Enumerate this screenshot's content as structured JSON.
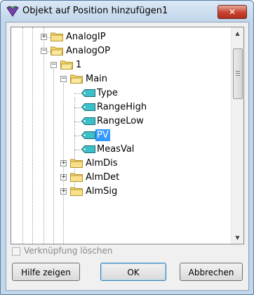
{
  "window": {
    "title": "Objekt auf Position hinzufügen1",
    "close_label": "✕"
  },
  "tree": {
    "nodes": [
      {
        "label": "AnalogIP",
        "kind": "folder",
        "expander": "+"
      },
      {
        "label": "AnalogOP",
        "kind": "folder",
        "expander": "−"
      },
      {
        "label": "1",
        "kind": "folder",
        "expander": "−"
      },
      {
        "label": "Main",
        "kind": "folder",
        "expander": "−"
      },
      {
        "label": "Type",
        "kind": "tag"
      },
      {
        "label": "RangeHigh",
        "kind": "tag"
      },
      {
        "label": "RangeLow",
        "kind": "tag"
      },
      {
        "label": "PV",
        "kind": "tag",
        "selected": true
      },
      {
        "label": "MeasVal",
        "kind": "tag"
      },
      {
        "label": "AlmDis",
        "kind": "folder",
        "expander": "+"
      },
      {
        "label": "AlmDet",
        "kind": "folder",
        "expander": "+"
      },
      {
        "label": "AlmSig",
        "kind": "folder",
        "expander": "+"
      }
    ]
  },
  "checkbox": {
    "label": "Verknüpfung löschen",
    "checked": false,
    "enabled": false
  },
  "buttons": {
    "help": "Hilfe zeigen",
    "ok": "OK",
    "cancel": "Abbrechen"
  },
  "colors": {
    "selection": "#3399ff",
    "folder": "#f3d36b",
    "tag": "#3bc0c9"
  }
}
